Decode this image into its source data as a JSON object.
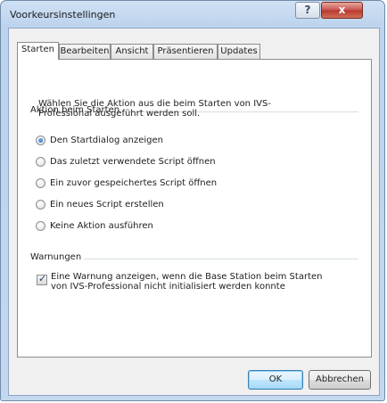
{
  "window": {
    "title": "Voorkeursinstellingen",
    "help_symbol": "?",
    "close_symbol": "x"
  },
  "tabs": [
    {
      "label": "Starten",
      "active": true
    },
    {
      "label": "Bearbeiten",
      "active": false
    },
    {
      "label": "Ansicht",
      "active": false
    },
    {
      "label": "Präsentieren",
      "active": false
    },
    {
      "label": "Updates",
      "active": false
    }
  ],
  "startup": {
    "group_label": "Aktion beim Starten",
    "description": "Wählen Sie die Aktion aus die beim Starten von IVS-Professional ausgeführt werden soll.",
    "options": [
      {
        "label": "Den Startdialog anzeigen",
        "selected": true
      },
      {
        "label": "Das zuletzt verwendete Script öffnen",
        "selected": false
      },
      {
        "label": "Ein zuvor gespeichertes Script öffnen",
        "selected": false
      },
      {
        "label": "Ein neues Script erstellen",
        "selected": false
      },
      {
        "label": "Keine Aktion ausführen",
        "selected": false
      }
    ]
  },
  "warnings": {
    "group_label": "Warnungen",
    "checkbox_label": "Eine Warnung anzeigen, wenn die Base Station beim Starten von IVS-Professional nicht initialisiert werden konnte",
    "checked": true
  },
  "buttons": {
    "ok": "OK",
    "cancel": "Abbrechen"
  },
  "colors": {
    "accent": "#3c7fb1",
    "close": "#c75050"
  }
}
